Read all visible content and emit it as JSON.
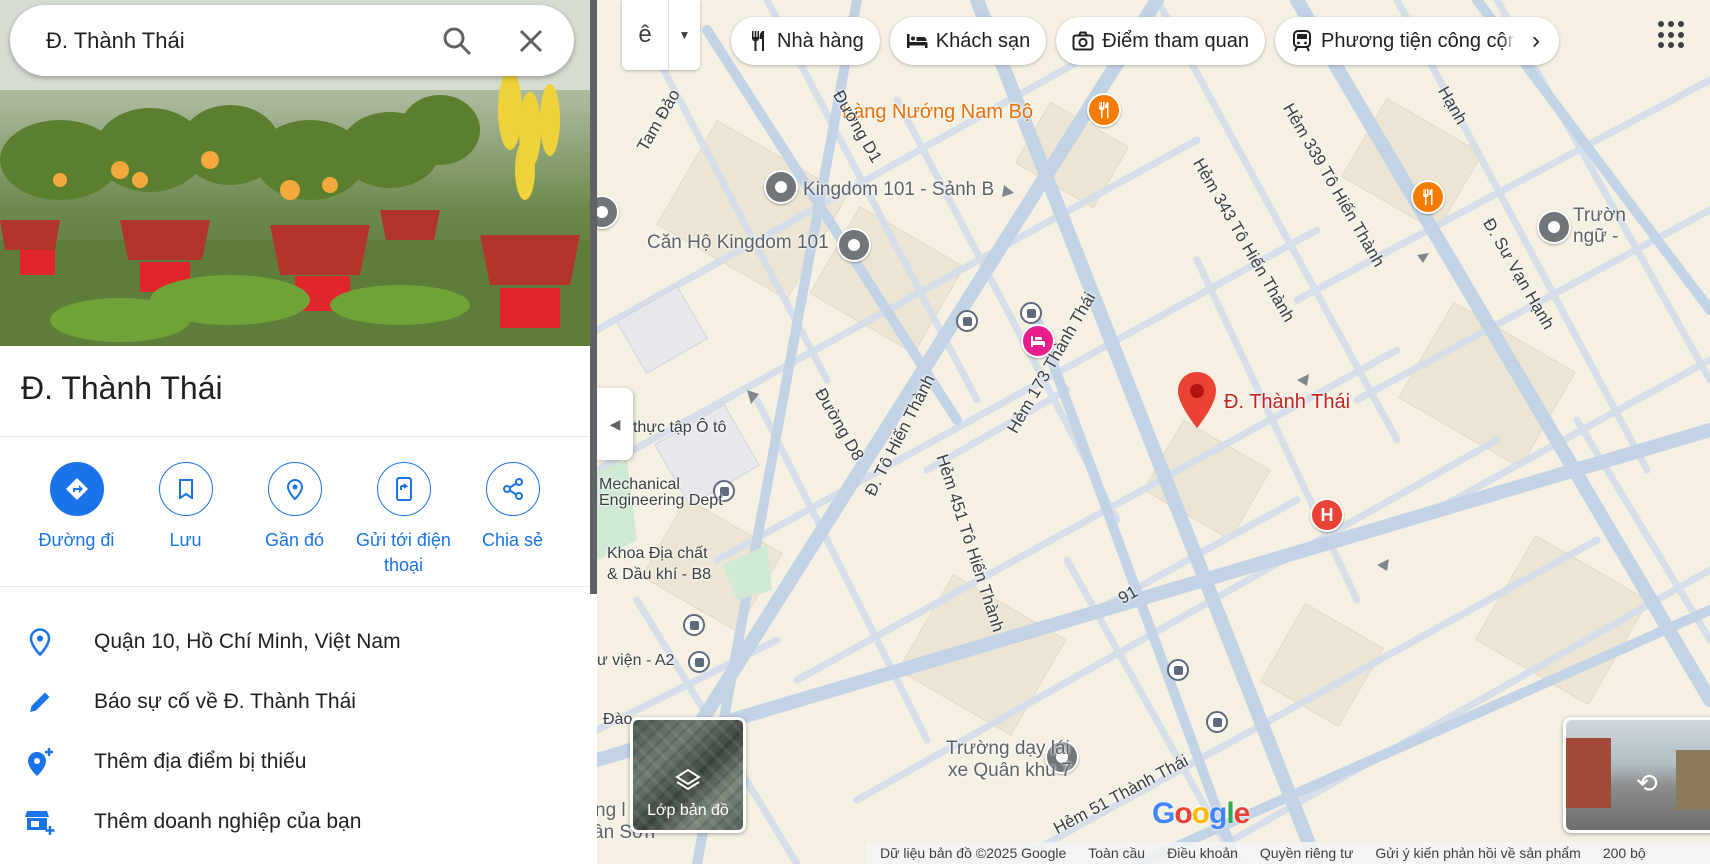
{
  "search": {
    "value": "Đ. Thành Thái"
  },
  "place": {
    "title": "Đ. Thành Thái",
    "actions": [
      {
        "label": "Đường đi",
        "icon": "directions-icon"
      },
      {
        "label": "Lưu",
        "icon": "bookmark-icon"
      },
      {
        "label": "Gần đó",
        "icon": "nearby-icon"
      },
      {
        "label": "Gửi tới điện thoại",
        "icon": "send-to-phone-icon"
      },
      {
        "label": "Chia sẻ",
        "icon": "share-icon"
      }
    ],
    "info": [
      {
        "text": "Quận 10, Hồ Chí Minh, Việt Nam",
        "icon": "location-pin-icon"
      },
      {
        "text": "Báo sự cố về Đ. Thành Thái",
        "icon": "pencil-icon"
      },
      {
        "text": "Thêm địa điểm bị thiếu",
        "icon": "add-location-icon"
      },
      {
        "text": "Thêm doanh nghiệp của bạn",
        "icon": "add-business-icon"
      }
    ]
  },
  "map": {
    "lang_glyph": "ê",
    "chips": [
      {
        "label": "Nhà hàng",
        "icon": "restaurant-icon"
      },
      {
        "label": "Khách sạn",
        "icon": "hotel-icon"
      },
      {
        "label": "Điểm tham quan",
        "icon": "camera-icon"
      },
      {
        "label": "Phương tiện công cộng",
        "icon": "transit-icon"
      }
    ],
    "labels": {
      "lang_nuong": "Làng Nướng Nam Bộ",
      "kingdom_b": "Kingdom 101 - Sảnh B",
      "can_ho": "Căn Hộ Kingdom 101",
      "selected": "Đ. Thành Thái",
      "thuc_tap": "ưng thực tập Ô tô",
      "mechanical_1": "Mechanical",
      "mechanical_2": "Engineering Dept",
      "khoa_1": "Khoa Địa chất",
      "khoa_2": "& Dầu khí - B8",
      "thu_vien": "ư viện - A2",
      "dao": "Đào",
      "truong_1": "Trường dạy lái",
      "truong_2": "xe Quân khu 7",
      "ng_l": "ng l",
      "an_son": "ân Sơn",
      "truon_1": "Trườn",
      "truon_2": "ngữ -",
      "num_91": "91"
    },
    "streets": {
      "tam_dao": "Tam Đảo",
      "duong_d1": "Đường D1",
      "duong_d8": "Đường D8",
      "to_hien_thanh": "Đ. Tô Hiến Thành",
      "hem_173": "Hẻm 173 Thành Thái",
      "hem_451": "Hẻm 451 Tô Hiến Thành",
      "hem_343": "Hẻm 343 Tô Hiến Thành",
      "hem_339": "Hẻm 339 Tô Hiến Thành",
      "su_van_hanh": "Đ. Sư Vạn Hạnh",
      "hanh": "Hạnh",
      "hem_51": "Hẻm 51 Thành Thái"
    },
    "layers_label": "Lớp bản đồ",
    "hospital_letter": "H",
    "footer": {
      "data": "Dữ liệu bản đồ ©2025 Google",
      "global": "Toàn cầu",
      "terms": "Điều khoản",
      "privacy": "Quyền riêng tư",
      "feedback": "Gửi ý kiến phản hồi về sản phẩm",
      "scale": "200 bộ"
    }
  },
  "colors": {
    "accent": "#1a73e8",
    "selected_pin": "#ea4335",
    "poi_orange": "#f57c00",
    "map_bg": "#f6f0e3",
    "road": "#c3d3e6"
  }
}
